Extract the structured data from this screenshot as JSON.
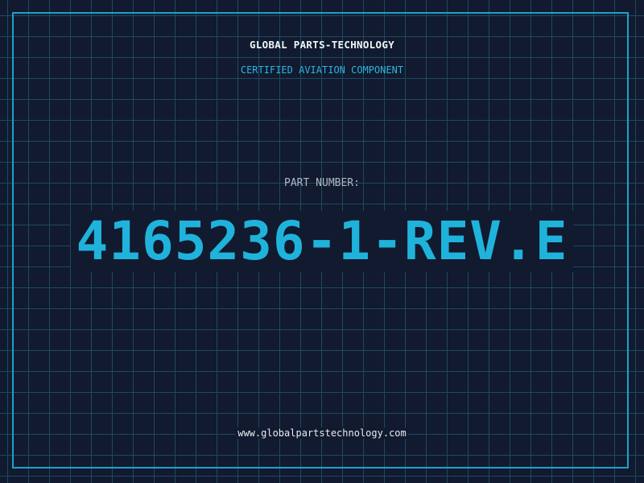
{
  "header": {
    "company": "GLOBAL PARTS-TECHNOLOGY",
    "subtitle": "CERTIFIED AVIATION COMPONENT"
  },
  "part": {
    "label": "PART NUMBER:",
    "number": "4165236-1-REV.E"
  },
  "footer": {
    "website": "www.globalpartstechnology.com"
  },
  "colors": {
    "background": "#111a2e",
    "grid": "#1d4a63",
    "accent": "#1fb3dc",
    "border": "#1aa3cc"
  }
}
